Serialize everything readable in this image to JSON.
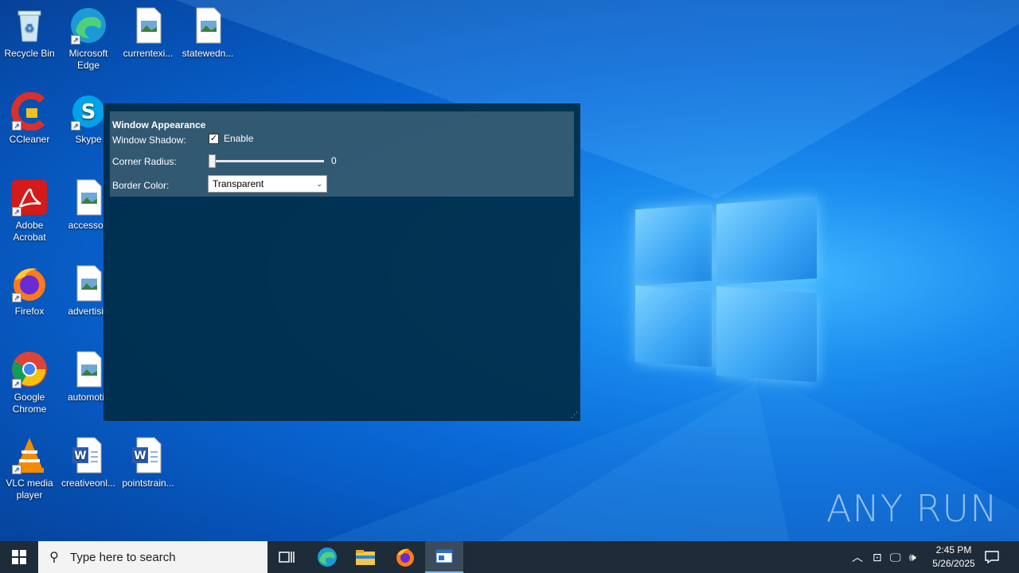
{
  "desktop": {
    "icons": [
      {
        "label": "Recycle Bin",
        "icon": "recycle-bin-icon"
      },
      {
        "label": "Microsoft Edge",
        "icon": "edge-icon"
      },
      {
        "label": "currentexi...",
        "icon": "image-file-icon"
      },
      {
        "label": "statewedn...",
        "icon": "image-file-icon"
      },
      {
        "label": "CCleaner",
        "icon": "ccleaner-icon"
      },
      {
        "label": "Skype",
        "icon": "skype-icon"
      },
      {
        "label": "Adobe Acrobat",
        "icon": "acrobat-icon"
      },
      {
        "label": "accessori",
        "icon": "image-file-icon"
      },
      {
        "label": "Firefox",
        "icon": "firefox-icon"
      },
      {
        "label": "advertisin",
        "icon": "image-file-icon"
      },
      {
        "label": "Google Chrome",
        "icon": "chrome-icon"
      },
      {
        "label": "automotiv",
        "icon": "image-file-icon"
      },
      {
        "label": "VLC media player",
        "icon": "vlc-icon"
      },
      {
        "label": "creativeonl...",
        "icon": "word-doc-icon"
      },
      {
        "label": "pointstrain...",
        "icon": "word-doc-icon"
      }
    ]
  },
  "window": {
    "section_title": "Window Appearance",
    "shadow_label": "Window Shadow:",
    "shadow_checkbox_label": "Enable",
    "shadow_checked": true,
    "radius_label": "Corner Radius:",
    "radius_value": "0",
    "border_label": "Border Color:",
    "border_value": "Transparent"
  },
  "watermark": "ANY RUN",
  "taskbar": {
    "search_placeholder": "Type here to search",
    "time": "2:45 PM",
    "date": "5/26/2025",
    "pinned": [
      "task-view-icon",
      "edge-icon",
      "file-explorer-icon",
      "firefox-icon",
      "app-window-icon"
    ]
  },
  "colors": {
    "taskbar": "#1e2b38",
    "window_bg": "#002d48",
    "accent": "#7bb7ef"
  }
}
